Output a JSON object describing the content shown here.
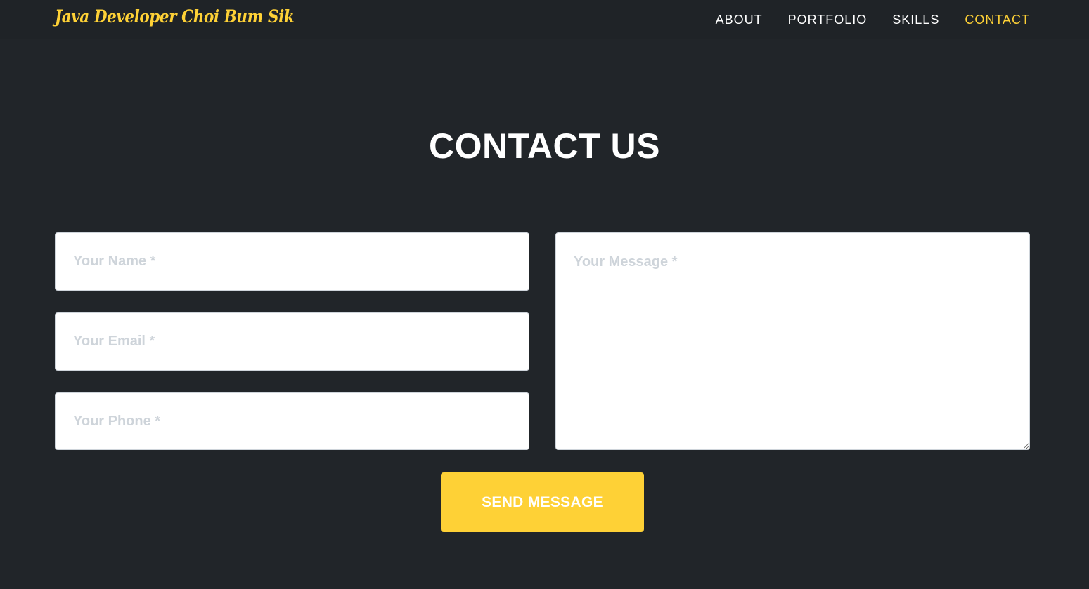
{
  "navbar": {
    "brand": "Java Developer Choi Bum Sik",
    "links": [
      {
        "label": "ABOUT",
        "active": false
      },
      {
        "label": "PORTFOLIO",
        "active": false
      },
      {
        "label": "SKILLS",
        "active": false
      },
      {
        "label": "CONTACT",
        "active": true
      }
    ]
  },
  "contact": {
    "heading": "CONTACT US",
    "form": {
      "name": {
        "value": "",
        "placeholder": "Your Name *"
      },
      "email": {
        "value": "",
        "placeholder": "Your Email *"
      },
      "phone": {
        "value": "",
        "placeholder": "Your Phone *"
      },
      "message": {
        "value": "",
        "placeholder": "Your Message *"
      },
      "submit_label": "SEND MESSAGE"
    }
  },
  "colors": {
    "background": "#212529",
    "navbar_background": "#1f2327",
    "accent": "#fed136",
    "heading_text": "#ffffff",
    "placeholder_text": "#ced4da"
  }
}
